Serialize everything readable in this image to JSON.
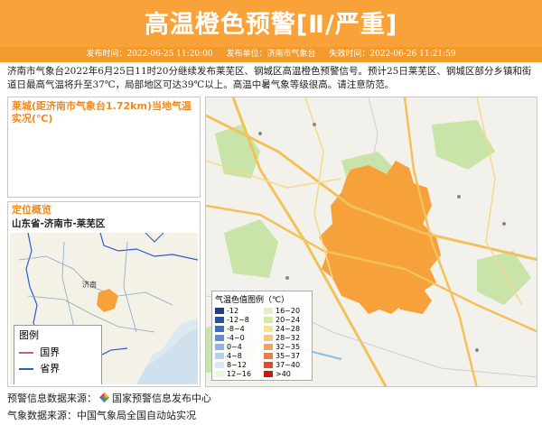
{
  "header": {
    "title": "高温橙色预警[Ⅱ/严重]",
    "issue_time": "发布时间：2022-06-25 11:20:00",
    "issuer": "发布单位：济南市气象台",
    "expire_time": "失效时间：2022-06-26 11:21:59"
  },
  "description": "济南市气象台2022年6月25日11时20分继续发布莱芜区、钢城区高温橙色预警信号。预计25日莱芜区、钢城区部分乡镇和街道日最高气温将升至37℃，局部地区可达39℃以上。高温中暑气象等级很高。请注意防范。",
  "temperature_panel": {
    "title": "莱城(距济南市气象台1.72km)当地气温实况(℃)"
  },
  "location_panel": {
    "title": "定位概览",
    "path": "山东省-济南市-莱芜区",
    "city_label": "济南",
    "legend_title": "图例",
    "legend_items": [
      {
        "label": "国界",
        "color": "#c0607a"
      },
      {
        "label": "省界",
        "color": "#2a5bd0"
      }
    ]
  },
  "temp_legend": {
    "title": "气温色值图例（℃）",
    "items": [
      {
        "label": "-12",
        "color": "#1c3c8e"
      },
      {
        "label": "16~20",
        "color": "#e8f0c0"
      },
      {
        "label": "-12~8",
        "color": "#2451a8"
      },
      {
        "label": "20~24",
        "color": "#d9eb9a"
      },
      {
        "label": "-8~4",
        "color": "#3b6ec2"
      },
      {
        "label": "24~28",
        "color": "#f3e58a"
      },
      {
        "label": "-4~0",
        "color": "#5e8fd6"
      },
      {
        "label": "28~32",
        "color": "#f8c779"
      },
      {
        "label": "0~4",
        "color": "#8db4e6"
      },
      {
        "label": "32~35",
        "color": "#f5a45c"
      },
      {
        "label": "4~8",
        "color": "#b5d2f0"
      },
      {
        "label": "35~37",
        "color": "#ef7c3f"
      },
      {
        "label": "8~12",
        "color": "#d7e8f8"
      },
      {
        "label": "37~40",
        "color": "#e34a26"
      },
      {
        "label": "12~16",
        "color": "#eef6e0"
      },
      {
        "label": ">40",
        "color": "#c81818"
      }
    ]
  },
  "footer": {
    "warning_source": "预警信息数据来源：",
    "warning_source_name": "国家预警信息发布中心",
    "weather_source": "气象数据来源：中国气象局全国自动站实况"
  },
  "colors": {
    "banner": "#f9a23a",
    "meta_bar": "#f29a2c",
    "warning_area": "#f7a13a",
    "panel_title": "#f08a1c"
  }
}
